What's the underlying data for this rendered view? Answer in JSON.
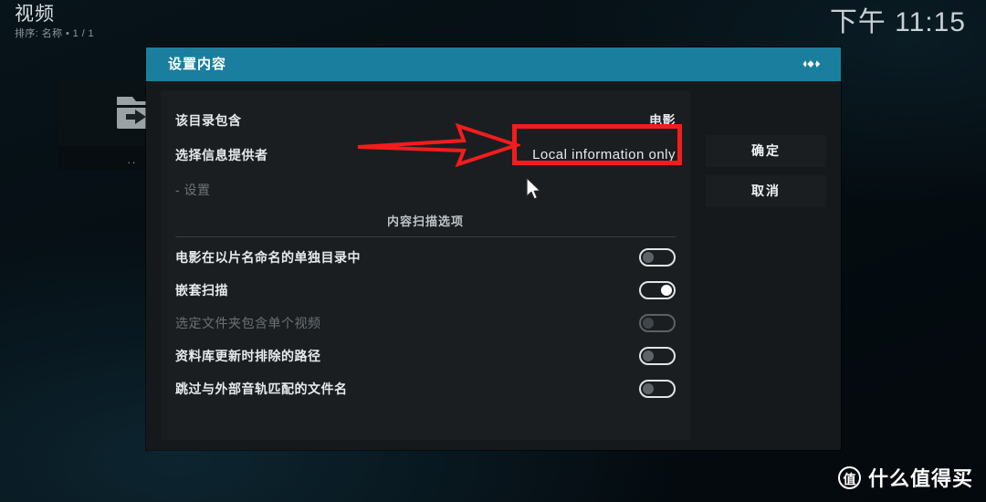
{
  "background": {
    "title": "视频",
    "subtitle": "排序: 名称  •  1 / 1",
    "clock": "下午 11:15",
    "file_item": {
      "icon": "parent-folder-icon",
      "caption": ".."
    }
  },
  "dialog": {
    "title": "设置内容",
    "logo": "kodi-logo",
    "info_rows": [
      {
        "label": "该目录包含",
        "value": "电影",
        "dim": false
      },
      {
        "label": "选择信息提供者",
        "value": "Local information only",
        "dim": false
      },
      {
        "label": "- 设置",
        "value": "",
        "dim": true
      }
    ],
    "section_heading": "内容扫描选项",
    "toggles": [
      {
        "label": "电影在以片名命名的单独目录中",
        "state": "off",
        "disabled": false
      },
      {
        "label": "嵌套扫描",
        "state": "on",
        "disabled": false
      },
      {
        "label": "选定文件夹包含单个视频",
        "state": "off",
        "disabled": true
      },
      {
        "label": "资料库更新时排除的路径",
        "state": "off",
        "disabled": false
      },
      {
        "label": "跳过与外部音轨匹配的文件名",
        "state": "off",
        "disabled": false
      }
    ],
    "buttons": {
      "ok": "确定",
      "cancel": "取消"
    }
  },
  "annotations": {
    "highlight_color": "#f41c1c",
    "arrow": "right-arrow-annotation",
    "box_target": "Local information only",
    "cursor": "mouse-pointer"
  },
  "watermark": {
    "badge": "值",
    "text": "什么值得买"
  },
  "theme": {
    "titlebar_teal": "#1a7f9e",
    "dialog_bg": "#16191c",
    "panel_bg": "#1b1e21",
    "text_primary": "#e6eaec",
    "text_dim": "#6d7478"
  }
}
